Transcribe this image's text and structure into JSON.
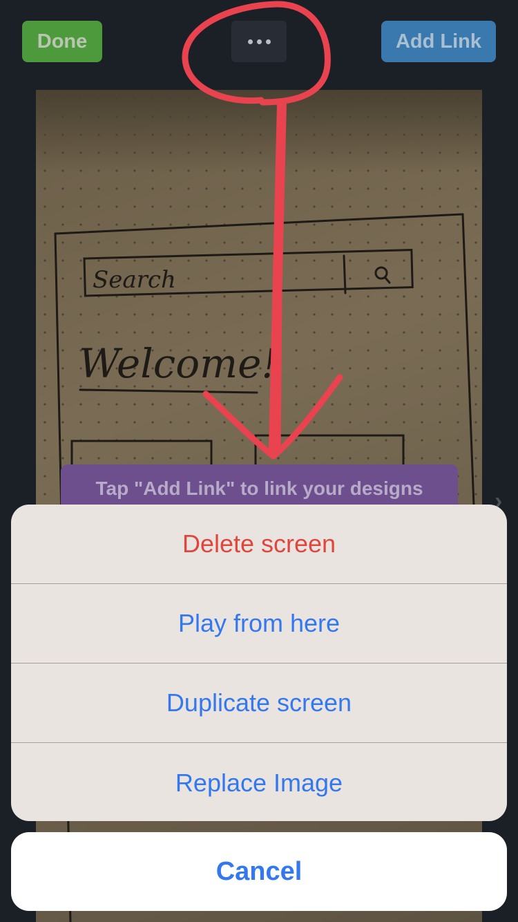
{
  "toolbar": {
    "done_label": "Done",
    "more_icon": "ellipsis-icon",
    "add_link_label": "Add Link"
  },
  "canvas": {
    "sketch_texts": [
      "Search",
      "Welcome!"
    ],
    "hint": "Tap \"Add Link\" to link your designs",
    "next_icon": "chevron-right-icon"
  },
  "action_sheet": {
    "items": [
      {
        "label": "Delete screen",
        "style": "destructive"
      },
      {
        "label": "Play from here",
        "style": "default"
      },
      {
        "label": "Duplicate screen",
        "style": "default"
      },
      {
        "label": "Replace Image",
        "style": "default"
      }
    ],
    "cancel_label": "Cancel"
  },
  "colors": {
    "destructive": "#e0463d",
    "action": "#3478f0",
    "annotation": "#e9434f"
  }
}
